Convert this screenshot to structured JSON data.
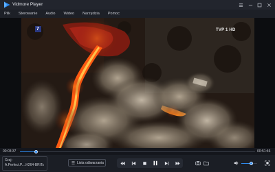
{
  "app": {
    "title": "Vidmore Player"
  },
  "menu": [
    {
      "label": "Plik"
    },
    {
      "label": "Sterowanie"
    },
    {
      "label": "Audio"
    },
    {
      "label": "Wideo"
    },
    {
      "label": "Narzędzia"
    },
    {
      "label": "Pomoc"
    }
  ],
  "video": {
    "badge_left": "7",
    "channel_logo": "TVP 1 HD"
  },
  "progress": {
    "elapsed": "00:03:37",
    "total": "00:51:46",
    "fraction": 0.07
  },
  "now_playing": {
    "label": "Graj:",
    "file": "A.Perfect.P....H264-BRiTs"
  },
  "playlist": {
    "label": "Lista odtwarzania"
  },
  "volume": {
    "level": 0.62
  },
  "colors": {
    "accent": "#2e8bf0",
    "background": "#14161c",
    "controls": "#1b1e25"
  },
  "icons": {
    "logo": "play-triangle-logo",
    "controls": [
      "rewind-icon",
      "step-back-icon",
      "stop-icon",
      "pause-icon",
      "step-forward-icon",
      "fast-forward-icon"
    ],
    "right": [
      "snapshot-icon",
      "folder-icon",
      "volume-icon",
      "fullscreen-icon"
    ]
  }
}
